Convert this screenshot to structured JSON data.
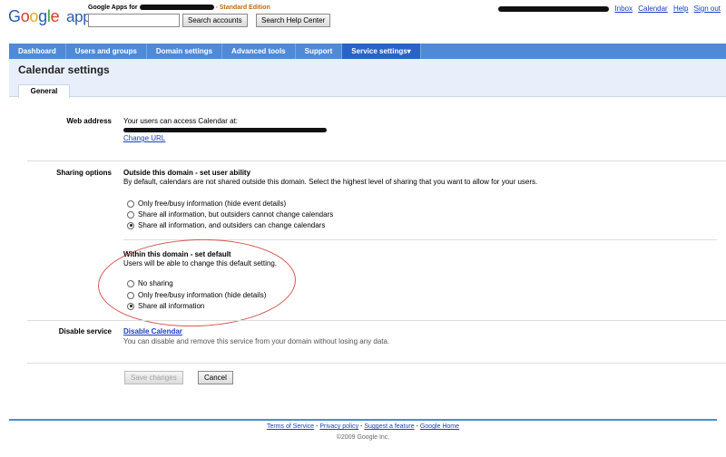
{
  "header": {
    "logo_text": "Google",
    "logo_suffix": "apps",
    "org_prefix": "Google Apps for",
    "edition": " - Standard Edition",
    "search_placeholder": "",
    "search_accounts_btn": "Search accounts",
    "search_help_btn": "Search Help Center",
    "links": [
      "Inbox",
      "Calendar",
      "Help",
      "Sign out"
    ]
  },
  "nav": {
    "items": [
      "Dashboard",
      "Users and groups",
      "Domain settings",
      "Advanced tools",
      "Support",
      "Service settings▾"
    ],
    "active_index": 5
  },
  "page": {
    "title": "Calendar settings",
    "tab": "General"
  },
  "web_address": {
    "label": "Web address",
    "intro": "Your users can access Calendar at:",
    "change_url": "Change URL"
  },
  "sharing": {
    "label": "Sharing options",
    "outside_title": "Outside this domain - set user ability",
    "outside_desc": "By default, calendars are not shared outside this domain. Select the highest level of sharing that you want to allow for your users.",
    "outside_options": [
      "Only free/busy information (hide event details)",
      "Share all information, but outsiders cannot change calendars",
      "Share all information, and outsiders can change calendars"
    ],
    "outside_selected": 2,
    "inside_title": "Within this domain - set default",
    "inside_desc": "Users will be able to change this default setting.",
    "inside_options": [
      "No sharing",
      "Only free/busy information (hide details)",
      "Share all information"
    ],
    "inside_selected": 2
  },
  "disable": {
    "label": "Disable service",
    "link": "Disable Calendar",
    "desc": "You can disable and remove this service from your domain without losing any data."
  },
  "actions": {
    "save": "Save changes",
    "cancel": "Cancel"
  },
  "footer": {
    "links": [
      "Terms of Service",
      "Privacy policy",
      "Suggest a feature",
      "Google Home"
    ],
    "copyright": "©2009 Google Inc."
  }
}
